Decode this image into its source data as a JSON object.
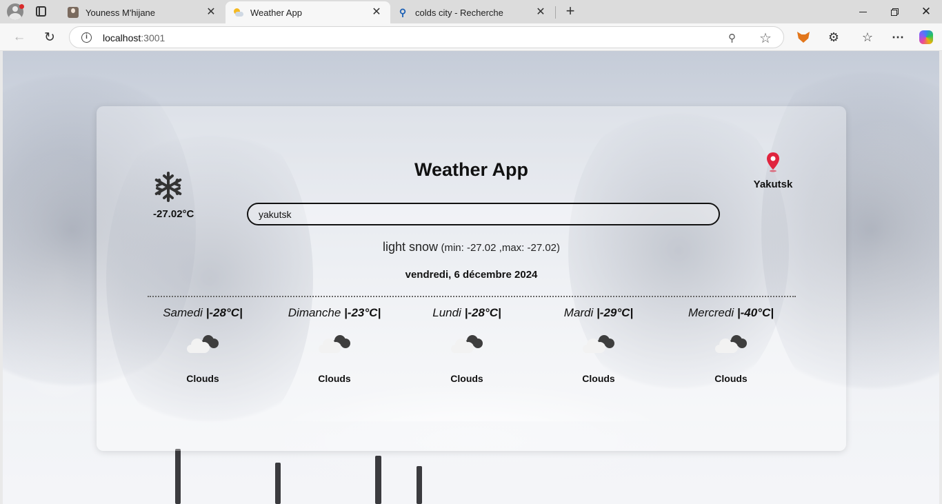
{
  "browser": {
    "tabs": [
      {
        "title": "Youness M'hijane",
        "favicon": "user-photo-icon",
        "close": "✕"
      },
      {
        "title": "Weather App",
        "favicon": "weather-icon",
        "close": "✕",
        "active": true
      },
      {
        "title": "colds city - Recherche",
        "favicon": "search-icon",
        "close": "✕"
      }
    ],
    "new_tab": "+",
    "url_host": "localhost",
    "url_port": ":3001"
  },
  "app": {
    "title": "Weather App",
    "current": {
      "icon": "snowflake-icon",
      "temp": "-27.02°C",
      "description": "light snow",
      "minmax": "(min: -27.02 ,max: -27.02)",
      "date": "vendredi, 6 décembre 2024"
    },
    "location": {
      "icon": "map-pin-icon",
      "city": "Yakutsk",
      "pin_color": "#e0243e"
    },
    "search": {
      "value": "yakutsk"
    },
    "forecast": [
      {
        "day": "Samedi",
        "temp": "|-28°C|",
        "desc": "Clouds",
        "icon": "clouds-icon"
      },
      {
        "day": "Dimanche",
        "temp": "|-23°C|",
        "desc": "Clouds",
        "icon": "clouds-icon"
      },
      {
        "day": "Lundi",
        "temp": "|-28°C|",
        "desc": "Clouds",
        "icon": "clouds-icon"
      },
      {
        "day": "Mardi",
        "temp": "|-29°C|",
        "desc": "Clouds",
        "icon": "clouds-icon"
      },
      {
        "day": "Mercredi",
        "temp": "|-40°C|",
        "desc": "Clouds",
        "icon": "clouds-icon"
      }
    ]
  }
}
